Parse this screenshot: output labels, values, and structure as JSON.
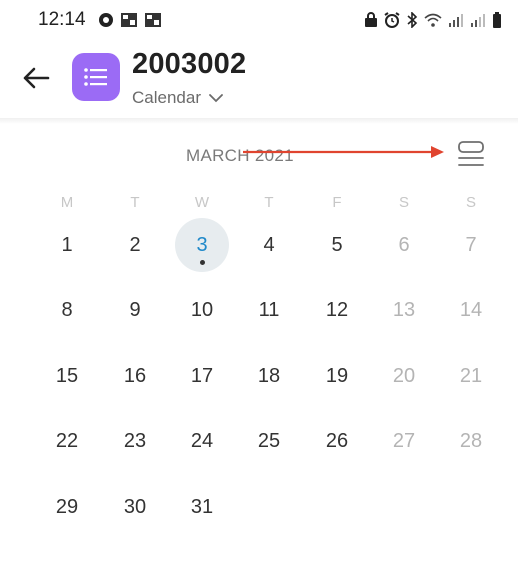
{
  "status": {
    "time": "12:14",
    "left_icons": [
      "notification-icon",
      "image-icon",
      "image-icon"
    ],
    "right_icons": [
      "lock-icon",
      "alarm-icon",
      "bluetooth-icon",
      "wifi-icon",
      "signal-icon",
      "signal-icon",
      "battery-icon"
    ]
  },
  "header": {
    "title": "2003002",
    "subtitle": "Calendar",
    "app_icon": "list-icon",
    "app_icon_color": "#9b6bf5"
  },
  "calendar": {
    "month_label": "MARCH 2021",
    "weekdays": [
      "M",
      "T",
      "W",
      "T",
      "F",
      "S",
      "S"
    ],
    "weeks": [
      [
        "1",
        "2",
        "3",
        "4",
        "5",
        "6",
        "7"
      ],
      [
        "8",
        "9",
        "10",
        "11",
        "12",
        "13",
        "14"
      ],
      [
        "15",
        "16",
        "17",
        "18",
        "19",
        "20",
        "21"
      ],
      [
        "22",
        "23",
        "24",
        "25",
        "26",
        "27",
        "28"
      ],
      [
        "29",
        "30",
        "31",
        "",
        "",
        "",
        ""
      ]
    ],
    "today": "3",
    "today_color": "#1e88c9",
    "annotation_arrow_color": "#e0442f"
  }
}
